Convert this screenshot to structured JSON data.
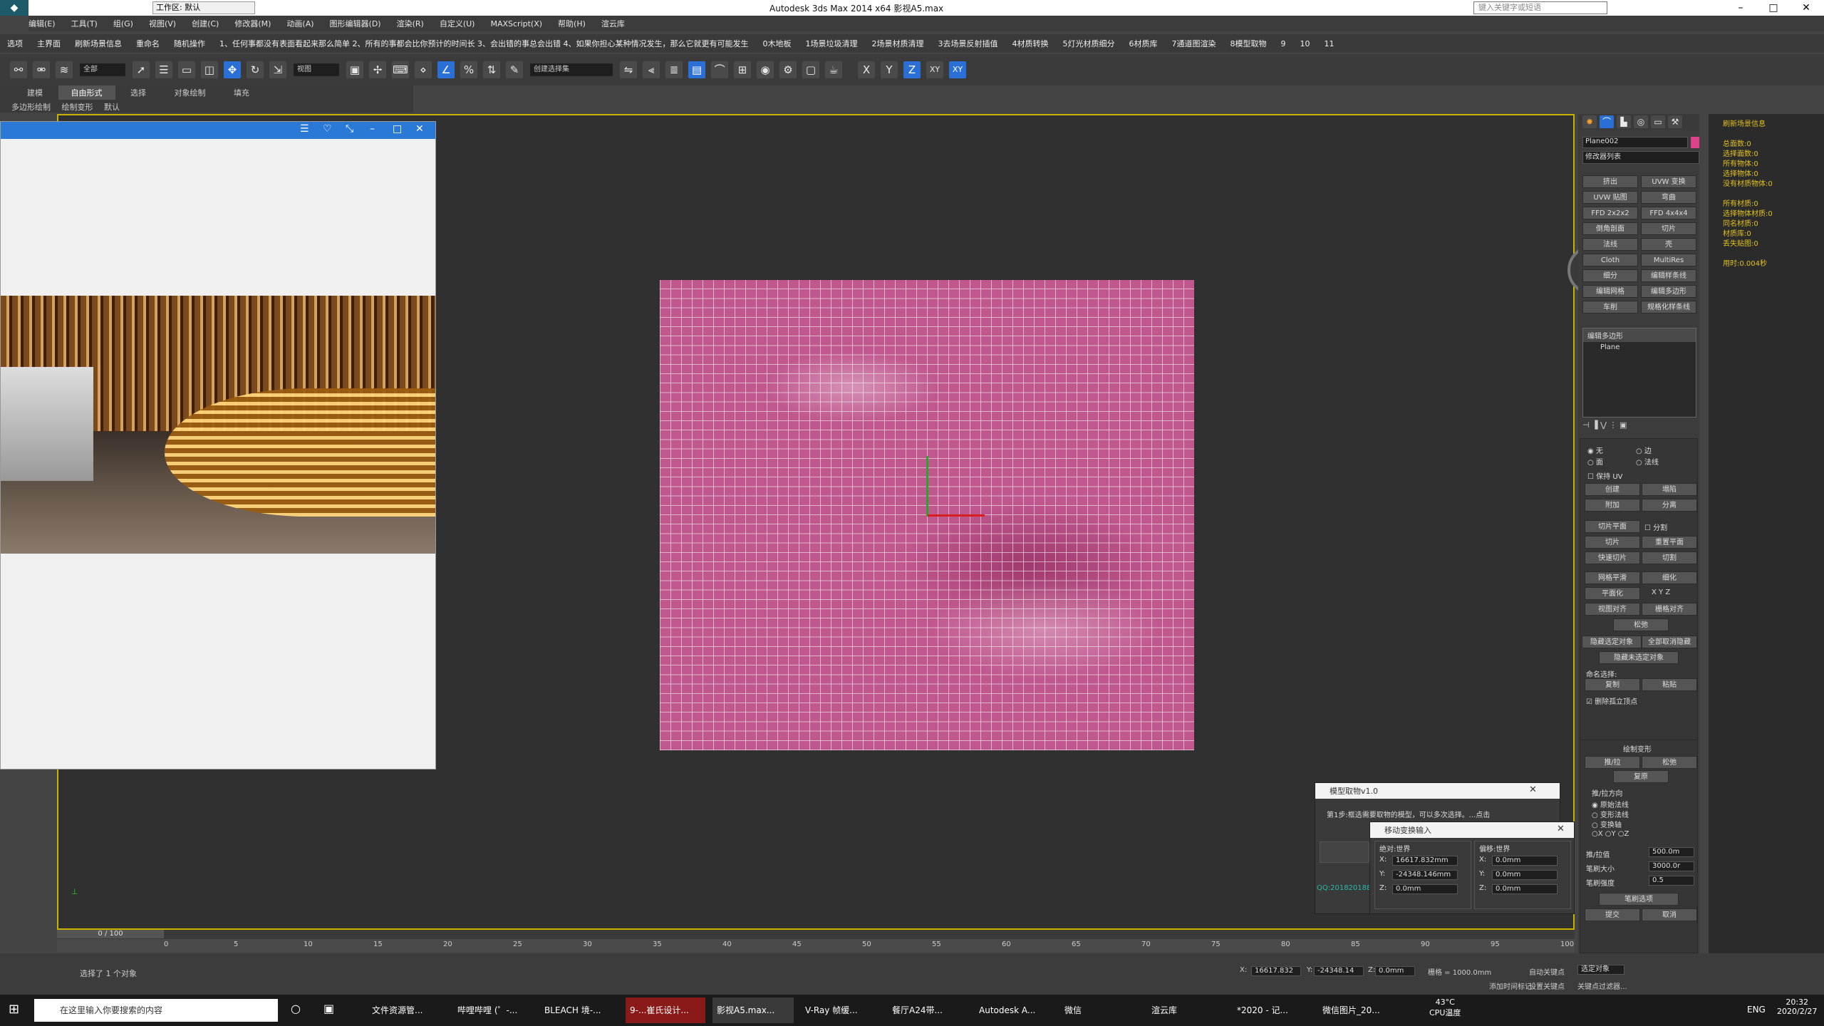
{
  "title_bar": {
    "title": "Autodesk 3ds Max  2014 x64      影视A5.max",
    "workspace": "工作区: 默认",
    "search_placeholder": "键入关键字或短语"
  },
  "menu": [
    "编辑(E)",
    "工具(T)",
    "组(G)",
    "视图(V)",
    "创建(C)",
    "修改器(M)",
    "动画(A)",
    "图形编辑器(D)",
    "渲染(R)",
    "自定义(U)",
    "MAXScript(X)",
    "帮助(H)",
    "渲云库"
  ],
  "plugin_bar": [
    "选项",
    "主界面",
    "刷新场景信息",
    "重命名",
    "随机操作",
    "1、任何事都没有表面看起来那么简单 2、所有的事都会比你预计的时间长 3、会出错的事总会出错 4、如果你担心某种情况发生，那么它就更有可能发生",
    "0木地板",
    "1场景垃圾清理",
    "2场景材质清理",
    "3去场景反射插值",
    "4材质转换",
    "5灯光材质细分",
    "6材质库",
    "7通道图渲染",
    "8模型取物",
    "9",
    "10",
    "11"
  ],
  "toolbar": {
    "select_filter": "全部",
    "ref_coord": "视图",
    "named_sel": "创建选择集",
    "axis_labels": [
      "X",
      "Y",
      "Z",
      "XY",
      "XY"
    ]
  },
  "ribbon": {
    "tabs": [
      "建模",
      "自由形式",
      "选择",
      "对象绘制",
      "填充"
    ],
    "active_tab": "自由形式",
    "sub": [
      "多边形绘制",
      "绘制变形",
      "默认"
    ]
  },
  "right_panel": {
    "object_name": "Plane002",
    "modifier_list": "修改器列表",
    "modifier_buttons": [
      "挤出",
      "UVW 变换",
      "UVW 贴图",
      "弯曲",
      "FFD 2x2x2",
      "FFD 4x4x4",
      "倒角剖面",
      "切片",
      "法线",
      "壳",
      "Cloth",
      "MultiRes",
      "细分",
      "编辑样条线",
      "编辑网格",
      "编辑多边形",
      "车削",
      "规格化样条线"
    ],
    "stack": [
      "编辑多边形",
      "Plane"
    ],
    "selection": {
      "none": "无",
      "edge": "边",
      "face": "面",
      "normal": "法线",
      "preserve_uv": "保持 UV",
      "create": "创建",
      "collapse": "塌陷",
      "attach": "附加",
      "detach": "分离",
      "slice_plane": "切片平面",
      "split": "分割",
      "slice": "切片",
      "reset_plane": "重置平面",
      "quickslice": "快速切片",
      "cut": "切割",
      "meshsmooth": "网格平滑",
      "tessellate": "细化",
      "make_planar": "平面化",
      "xyz": [
        "X",
        "Y",
        "Z"
      ],
      "view_align": "视图对齐",
      "grid_align": "栅格对齐",
      "relax": "松弛",
      "hide_sel": "隐藏选定对象",
      "unhide_all": "全部取消隐藏",
      "hide_unsel": "隐藏未选定对象",
      "named_sel": "命名选择:",
      "copy": "复制",
      "paste": "粘贴",
      "delete_iso": "删除孤立顶点"
    },
    "paint_deform": {
      "header": "绘制变形",
      "push_pull": "推/拉",
      "relax": "松弛",
      "revert": "复原",
      "direction": "推/拉方向",
      "orig_normal": "原始法线",
      "deformed_normal": "变形法线",
      "transform_axis": "变换轴",
      "axes": [
        "X",
        "Y",
        "Z"
      ],
      "push_value_label": "推/拉值",
      "push_value": "500.0m",
      "brush_size_label": "笔刷大小",
      "brush_size": "3000.0r",
      "brush_strength_label": "笔刷强度",
      "brush_strength": "0.5",
      "brush_options": "笔刷选项",
      "commit": "提交",
      "cancel": "取消"
    }
  },
  "info_panel": [
    "刷新场景信息",
    "",
    "总面数:0",
    "选择面数:0",
    "所有物体:0",
    "选择物体:0",
    "没有材质物体:0",
    "",
    "所有材质:0",
    "选择物体材质:0",
    "同名材质:0",
    "材质库:0",
    "丢失贴图:0",
    "",
    "用时:0.004秒"
  ],
  "dialog_model": {
    "title": "模型取物v1.0",
    "step": "第1步:框选需要取物的模型，可以多次选择。...点击",
    "link": "QQ:2018201888"
  },
  "dialog_transform": {
    "title": "移动变换输入",
    "absolute": "绝对:世界",
    "offset": "偏移:世界",
    "abs_x": "16617.832mm",
    "abs_y": "-24348.146mm",
    "abs_z": "0.0mm",
    "off_x": "0.0mm",
    "off_y": "0.0mm",
    "off_z": "0.0mm"
  },
  "timeline": {
    "frame": "0 / 100",
    "ticks": [
      "0",
      "5",
      "10",
      "15",
      "20",
      "25",
      "30",
      "35",
      "40",
      "45",
      "50",
      "55",
      "60",
      "65",
      "70",
      "75",
      "80",
      "85",
      "90",
      "95",
      "100"
    ]
  },
  "status": {
    "selected": "选择了 1 个对象",
    "x": "16617.832",
    "y": "-24348.14",
    "z": "0.0mm",
    "grid": "栅格 = 1000.0mm",
    "auto_key": "自动关键点",
    "set_key": "设置关键点",
    "key_filter": "关键点过滤器...",
    "sel_obj": "选定对象",
    "add_time_tag": "添加时间标记"
  },
  "taskbar": {
    "search": "在这里输入你要搜索的内容",
    "items": [
      "文件资源管...",
      "哔哩哔哩 (゜-...",
      "BLEACH 境-...",
      "9-...崔氏设计...",
      "影视A5.max...",
      "V-Ray 帧缓...",
      "餐厅A24带...",
      "Autodesk A...",
      "微信",
      "渲云库",
      "*2020 - 记...",
      "微信图片_20..."
    ],
    "temp": "43°C",
    "temp_label": "CPU温度",
    "lang": "ENG",
    "time": "20:32",
    "date": "2020/2/27"
  }
}
